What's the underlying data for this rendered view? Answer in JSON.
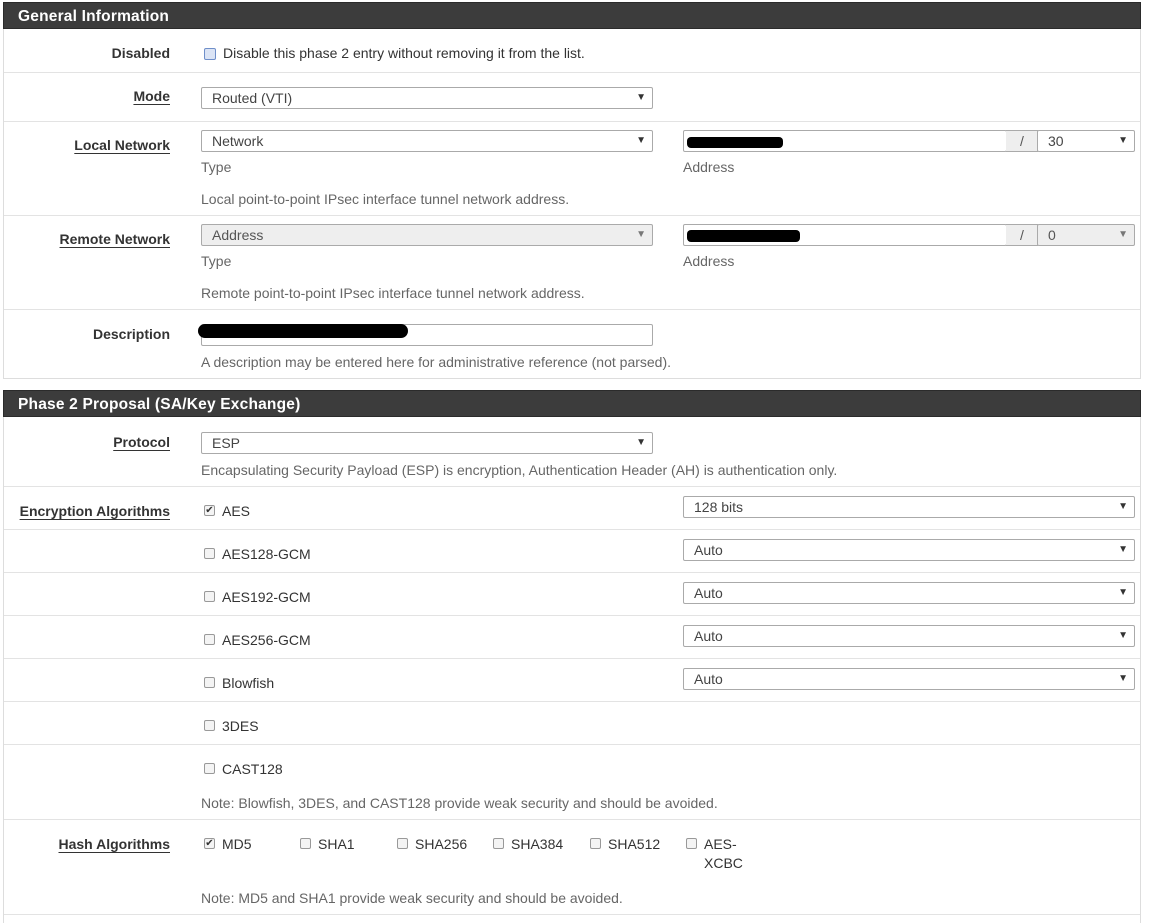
{
  "general": {
    "header": "General Information",
    "disabled": {
      "label": "Disabled",
      "text": "Disable this phase 2 entry without removing it from the list."
    },
    "mode": {
      "label": "Mode",
      "value": "Routed (VTI)"
    },
    "local": {
      "label": "Local Network",
      "type_value": "Network",
      "type_sub": "Type",
      "address_sub": "Address",
      "slash": "/",
      "mask": "30",
      "help": "Local point-to-point IPsec interface tunnel network address."
    },
    "remote": {
      "label": "Remote Network",
      "type_value": "Address",
      "type_sub": "Type",
      "address_sub": "Address",
      "slash": "/",
      "mask": "0",
      "help": "Remote point-to-point IPsec interface tunnel network address."
    },
    "description": {
      "label": "Description",
      "help": "A description may be entered here for administrative reference (not parsed)."
    }
  },
  "phase2": {
    "header": "Phase 2 Proposal (SA/Key Exchange)",
    "protocol": {
      "label": "Protocol",
      "value": "ESP",
      "help": "Encapsulating Security Payload (ESP) is encryption, Authentication Header (AH) is authentication only."
    },
    "encryption": {
      "label": "Encryption Algorithms",
      "items": [
        {
          "name": "AES",
          "checked": true,
          "keylen": "128 bits"
        },
        {
          "name": "AES128-GCM",
          "checked": false,
          "keylen": "Auto"
        },
        {
          "name": "AES192-GCM",
          "checked": false,
          "keylen": "Auto"
        },
        {
          "name": "AES256-GCM",
          "checked": false,
          "keylen": "Auto"
        },
        {
          "name": "Blowfish",
          "checked": false,
          "keylen": "Auto"
        },
        {
          "name": "3DES",
          "checked": false
        },
        {
          "name": "CAST128",
          "checked": false
        }
      ],
      "note": "Note: Blowfish, 3DES, and CAST128 provide weak security and should be avoided."
    },
    "hash": {
      "label": "Hash Algorithms",
      "items": [
        {
          "name": "MD5",
          "checked": true
        },
        {
          "name": "SHA1",
          "checked": false
        },
        {
          "name": "SHA256",
          "checked": false
        },
        {
          "name": "SHA384",
          "checked": false
        },
        {
          "name": "SHA512",
          "checked": false
        },
        {
          "name": "AES-",
          "name2": "XCBC",
          "checked": false
        }
      ],
      "note": "Note: MD5 and SHA1 provide weak security and should be avoided."
    }
  },
  "icons": {
    "dropdown": "chevron-down-icon",
    "checkmark": "check-icon"
  },
  "colors": {
    "header_bg": "#3c3c3c",
    "header_text": "#ffffff",
    "help_text": "#666666"
  }
}
